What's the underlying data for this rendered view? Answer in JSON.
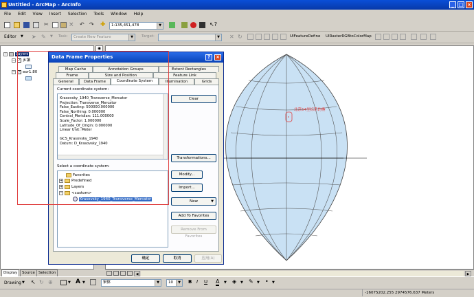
{
  "window": {
    "title": "Untitled - ArcMap - ArcInfo"
  },
  "menu": [
    "File",
    "Edit",
    "View",
    "Insert",
    "Selection",
    "Tools",
    "Window",
    "Help"
  ],
  "toolbar": {
    "scale": "1:135,451,478",
    "editor": "Editor",
    "task_label": "Task:",
    "task_value": "Create New Feature",
    "target_label": "Target:",
    "custom_tool_1": "UIFeatureDefine",
    "custom_tool_2": "UIRasterRGBtoColorMap"
  },
  "toc": {
    "layers": "Layers",
    "layer1": "乡镇",
    "layer2": "eor1.80",
    "tabs": [
      "Display",
      "Source",
      "Selection"
    ]
  },
  "map": {
    "annotation": "北京54坐标系的椭"
  },
  "dialog": {
    "title": "Data Frame Properties",
    "tabs_row1": [
      "Map Cache",
      "Annotation Groups",
      "Extent Rectangles"
    ],
    "tabs_row2": [
      "Frame",
      "Size and Position",
      "Feature Link"
    ],
    "tabs_row3": [
      "General",
      "Data Frame",
      "Coordinate System",
      "Illumination",
      "Grids"
    ],
    "current_label": "Current coordinate system:",
    "current_lines": [
      "Krasovsky_1940_Transverse_Mercator",
      "Projection: Transverse_Mercator",
      "False_Easting: 500000.000000",
      "False_Northing: 0.000000",
      "Central_Meridian: 111.000000",
      "Scale_Factor: 1.000000",
      "Latitude_Of_Origin: 0.000000",
      "Linear Unit: Meter",
      "",
      "GCS_Krasovsky_1940",
      "Datum: D_Krasovsky_1940"
    ],
    "select_label": "Select a coordinate system:",
    "tree": [
      "Favorites",
      "Predefined",
      "Layers",
      "<custom>",
      "Krasovsky_1940_Transverse_Mercator"
    ],
    "buttons": {
      "clear": "Clear",
      "transformations": "Transformations...",
      "modify": "Modify...",
      "import": "Import...",
      "new": "New",
      "add_fav": "Add To Favorites",
      "remove_fav": "Remove From Favorites",
      "ok": "确定",
      "cancel": "取消",
      "apply": "应用(A)"
    }
  },
  "drawing": {
    "label": "Drawing",
    "font": "宋体",
    "size": "10"
  },
  "status": {
    "coords": "-16075202.255  2974576.637 Meters"
  }
}
